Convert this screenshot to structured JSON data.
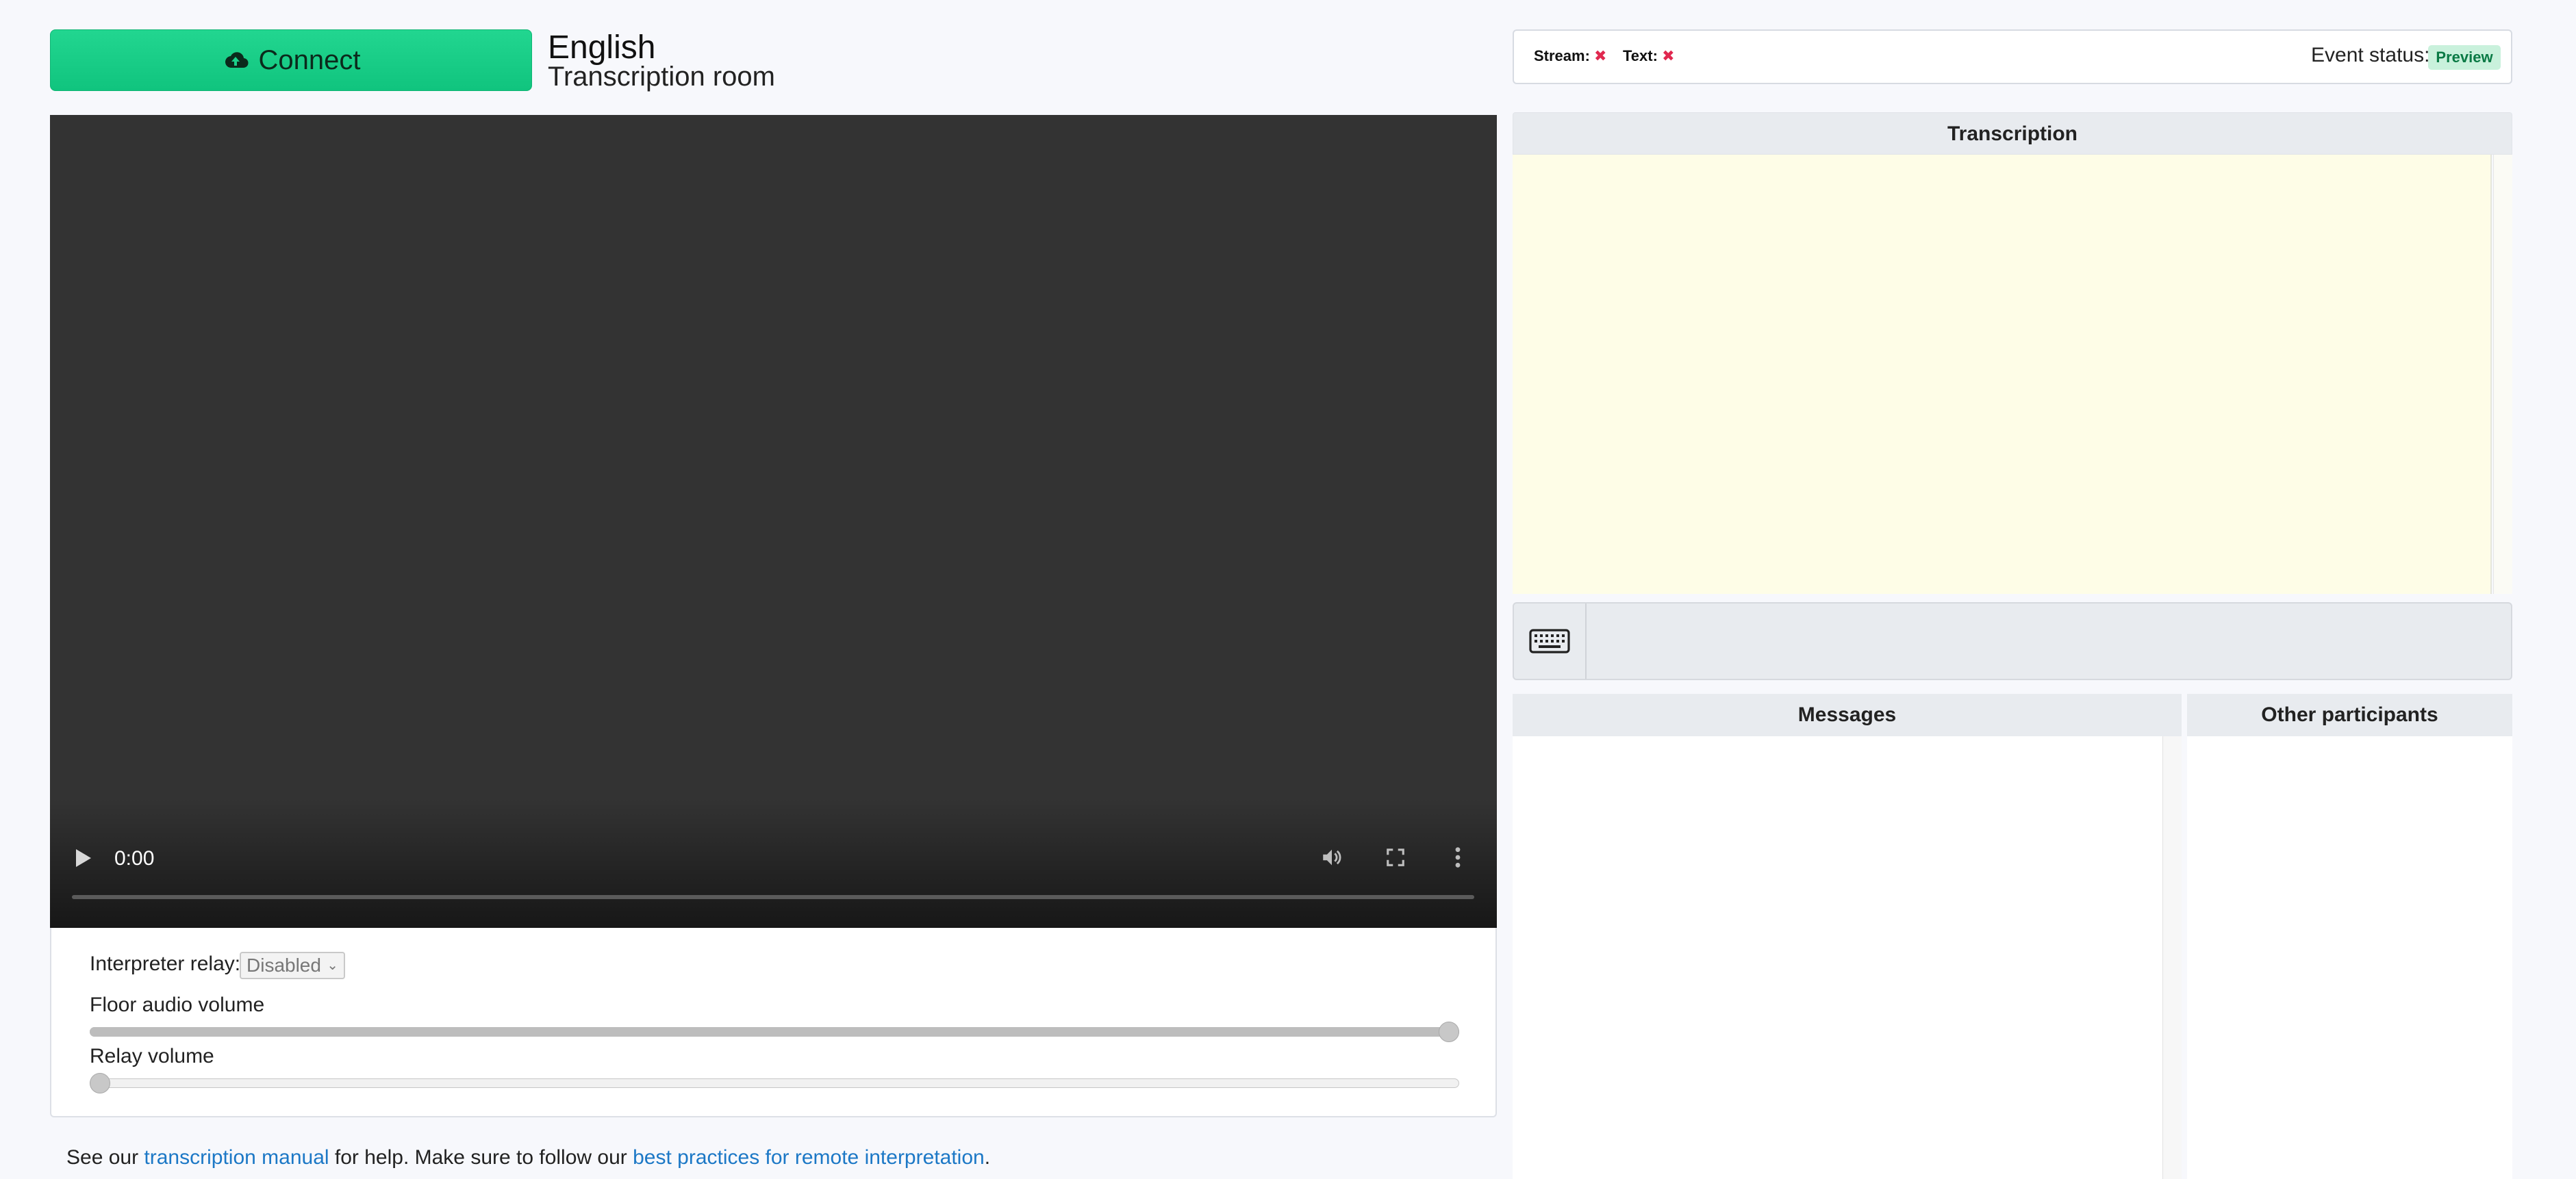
{
  "connect": {
    "label": "Connect",
    "icon": "cloud-upload-icon",
    "color": "#1bd08a"
  },
  "room": {
    "language": "English",
    "name": "Transcription room"
  },
  "video": {
    "time": "0:00",
    "progress": 0
  },
  "controls": {
    "relay_label": "Interpreter relay:",
    "relay_selected": "Disabled",
    "floor_volume_label": "Floor audio volume",
    "floor_volume": 1.0,
    "relay_volume_label": "Relay volume",
    "relay_volume": 0.0
  },
  "help": {
    "prefix": "See our ",
    "manual_link": "transcription manual",
    "middle": " for help. Make sure to follow our ",
    "practices_link": "best practices for remote interpretation",
    "suffix": "."
  },
  "status": {
    "stream_label": "Stream:",
    "text_label": "Text:",
    "event_status_label": "Event status:",
    "event_status_value": "Preview",
    "error_color": "#e0284f"
  },
  "panels": {
    "transcription": "Transcription",
    "messages": "Messages",
    "participants": "Other participants"
  },
  "input": {
    "icon": "keyboard-icon",
    "value": ""
  }
}
